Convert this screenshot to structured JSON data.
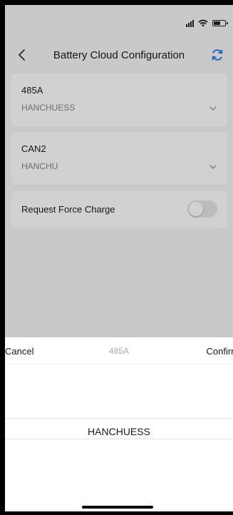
{
  "nav": {
    "title": "Battery Cloud Configuration"
  },
  "cards": [
    {
      "label": "485A",
      "value": "HANCHUESS"
    },
    {
      "label": "CAN2",
      "value": "HANCHU"
    }
  ],
  "force_charge": {
    "label": "Request Force Charge",
    "enabled": false
  },
  "picker": {
    "cancel_label": "Cancel",
    "title": "485A",
    "confirm_label": "Confirm",
    "selected_value": "HANCHUESS"
  },
  "colors": {
    "accent": "#1f7ae0",
    "background": "#f6f6f7",
    "toggle_off": "#e6e6e8"
  },
  "icons": {
    "back": "chevron-left-icon",
    "refresh": "refresh-icon",
    "dropdown": "chevron-down-icon"
  }
}
